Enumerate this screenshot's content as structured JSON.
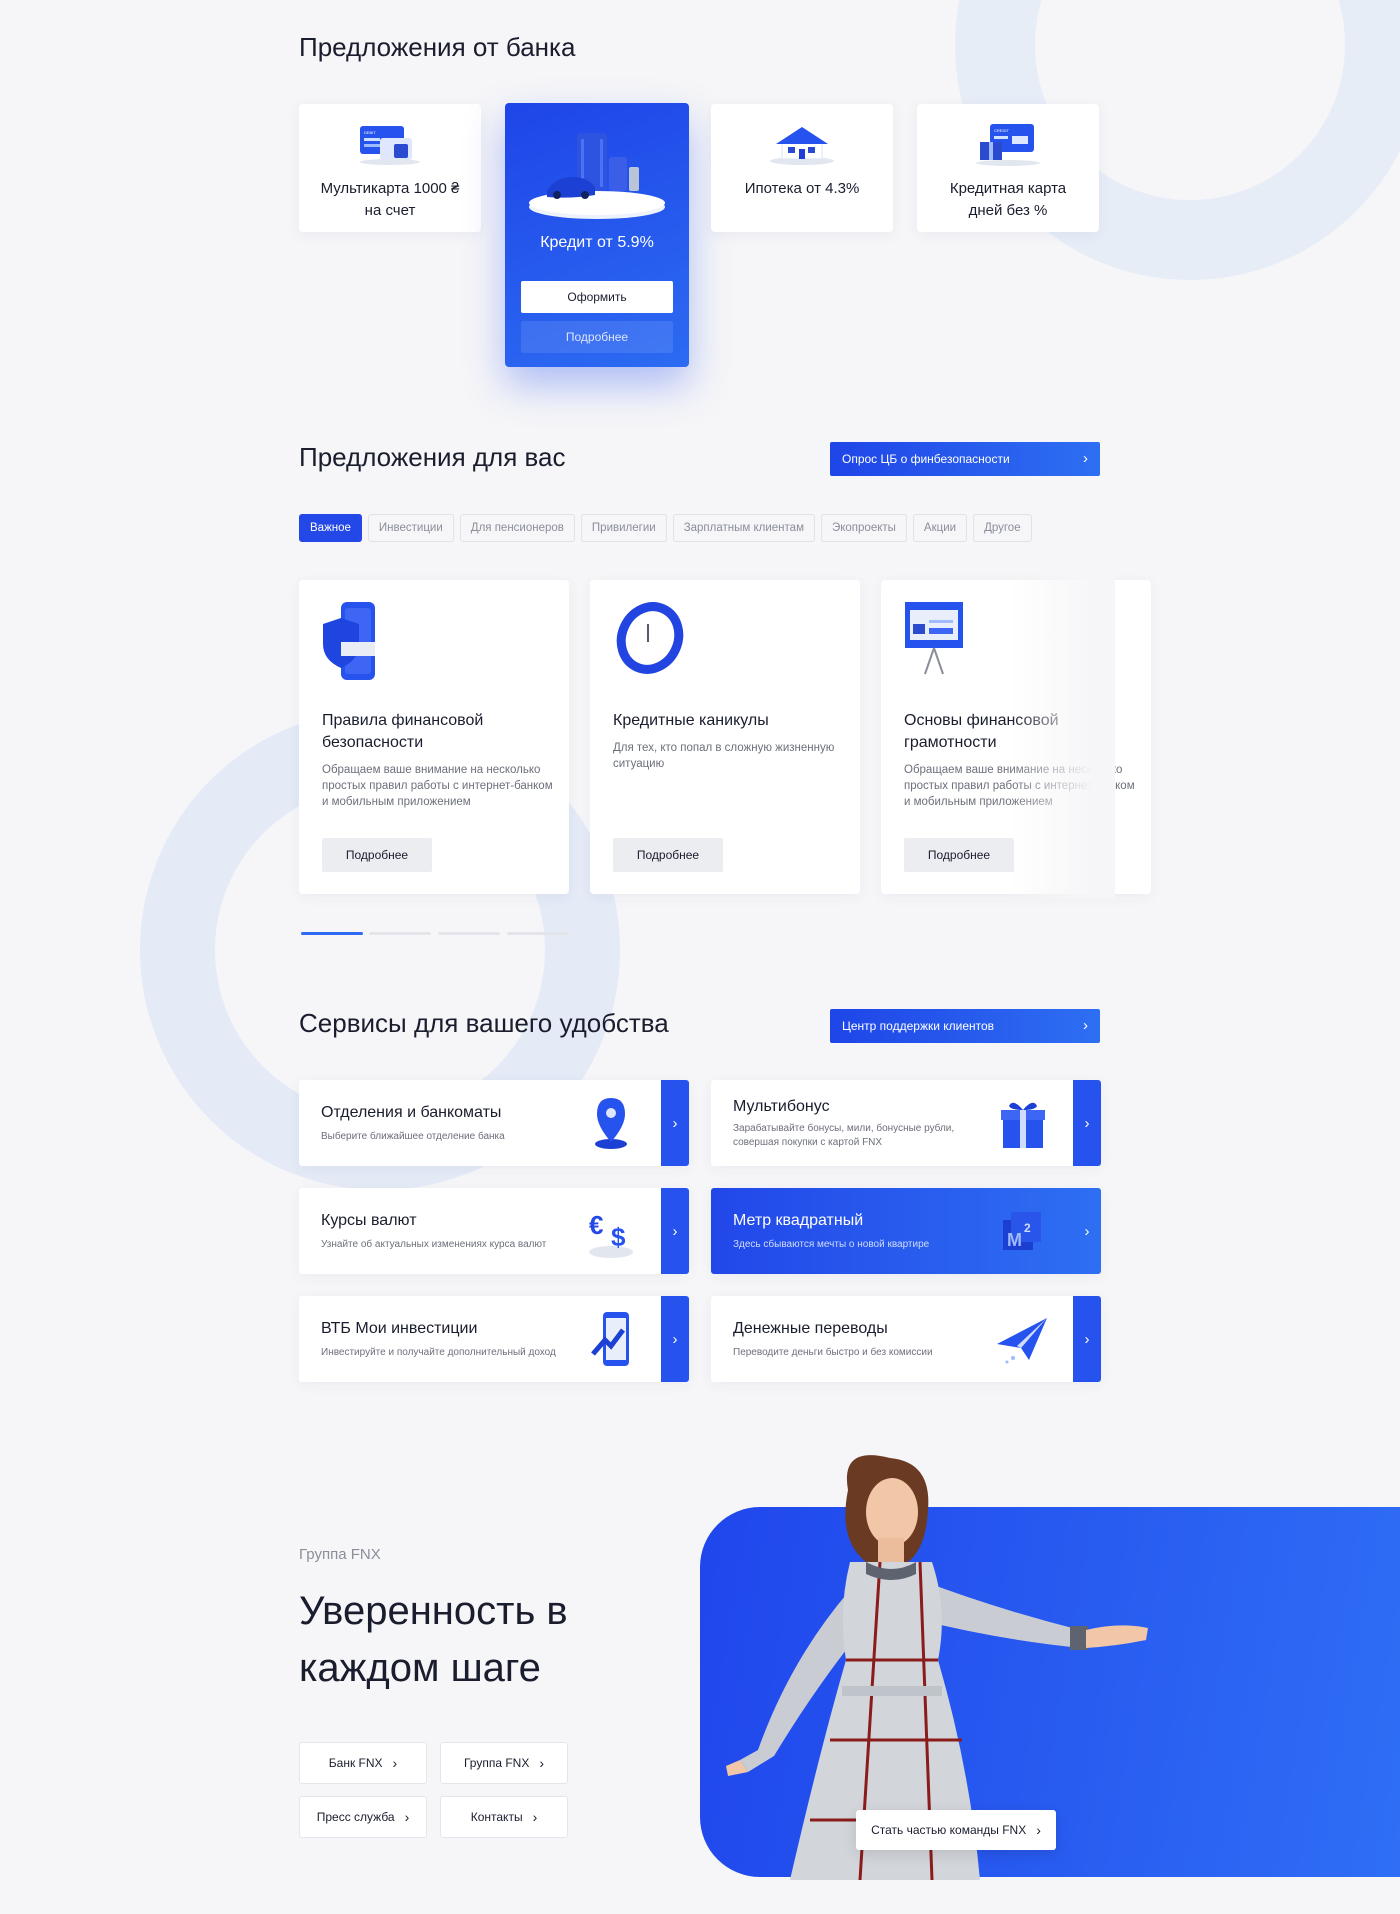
{
  "offers": {
    "title": "Предложения от банка",
    "items": [
      {
        "line1": "Мультикарта 1000 ₴",
        "line2": "на счет"
      },
      {
        "line1": "Ипотека от 4.3%",
        "line2": ""
      },
      {
        "line1": "Кредитная карта",
        "line2": "дней без %"
      }
    ],
    "featured": {
      "title": "Кредит от 5.9%",
      "apply_label": "Оформить",
      "more_label": "Подробнее"
    },
    "card_icon_labels": {
      "debit": "DEBIT",
      "credit": "CREDIT"
    }
  },
  "for_you": {
    "title": "Предложения для вас",
    "survey_button": "Опрос ЦБ о финбезопасности",
    "chips": [
      "Важное",
      "Инвестиции",
      "Для пенсионеров",
      "Привилегии",
      "Зарплатным клиентам",
      "Экопроекты",
      "Акции",
      "Другое"
    ],
    "cards": [
      {
        "title": "Правила финансовой безопасности",
        "desc": "Обращаем ваше внимание на несколько простых правил работы с интернет-банком и мобильным приложением",
        "more": "Подробнее",
        "icon": "shield-phone-icon"
      },
      {
        "title": "Кредитные каникулы",
        "desc": "Для тех, кто попал в сложную жизненную ситуацию",
        "more": "Подробнее",
        "icon": "clock-icon"
      },
      {
        "title": "Основы финансовой грамотности",
        "desc": "Обращаем ваше внимание на несколько простых правил работы с интернет-банком и мобильным приложением",
        "more": "Подробнее",
        "icon": "presentation-board-icon"
      }
    ],
    "pager_count": 4,
    "pager_active": 0
  },
  "services": {
    "title": "Сервисы для вашего удобства",
    "support_button": "Центр поддержки клиентов",
    "items": [
      {
        "title": "Отделения и банкоматы",
        "sub": "Выберите ближайшее отделение банка",
        "icon": "location-pin-icon"
      },
      {
        "title": "Мультибонус",
        "sub": "Зарабатывайте бонусы, мили, бонусные рубли, совершая покупки с картой FNX",
        "icon": "gift-icon"
      },
      {
        "title": "Курсы валют",
        "sub": "Узнайте об актуальных изменениях курса валют",
        "icon": "currency-exchange-icon"
      },
      {
        "title": "Метр квадратный",
        "sub": "Здесь сбываются мечты о новой квартире",
        "icon": "square-meter-icon",
        "m2": "M",
        "m2sup": "2"
      },
      {
        "title": "ВТБ Мои инвестиции",
        "sub": "Инвестируйте и получайте дополнительный доход",
        "icon": "phone-chart-icon"
      },
      {
        "title": "Денежные переводы",
        "sub": "Переводите деньги быстро и без комиссии",
        "icon": "paper-plane-icon"
      }
    ]
  },
  "group": {
    "kicker": "Группа FNX",
    "title": "Уверенность в каждом шаге",
    "links": [
      "Банк FNX",
      "Группа FNX",
      "Пресс служба",
      "Контакты"
    ],
    "join_button": "Стать частью команды FNX"
  },
  "colors": {
    "accent": "#2448e8",
    "accent_light": "#2e6ff2",
    "background": "#f6f6f8",
    "text": "#1a1d2e",
    "muted": "#8a8e99"
  }
}
